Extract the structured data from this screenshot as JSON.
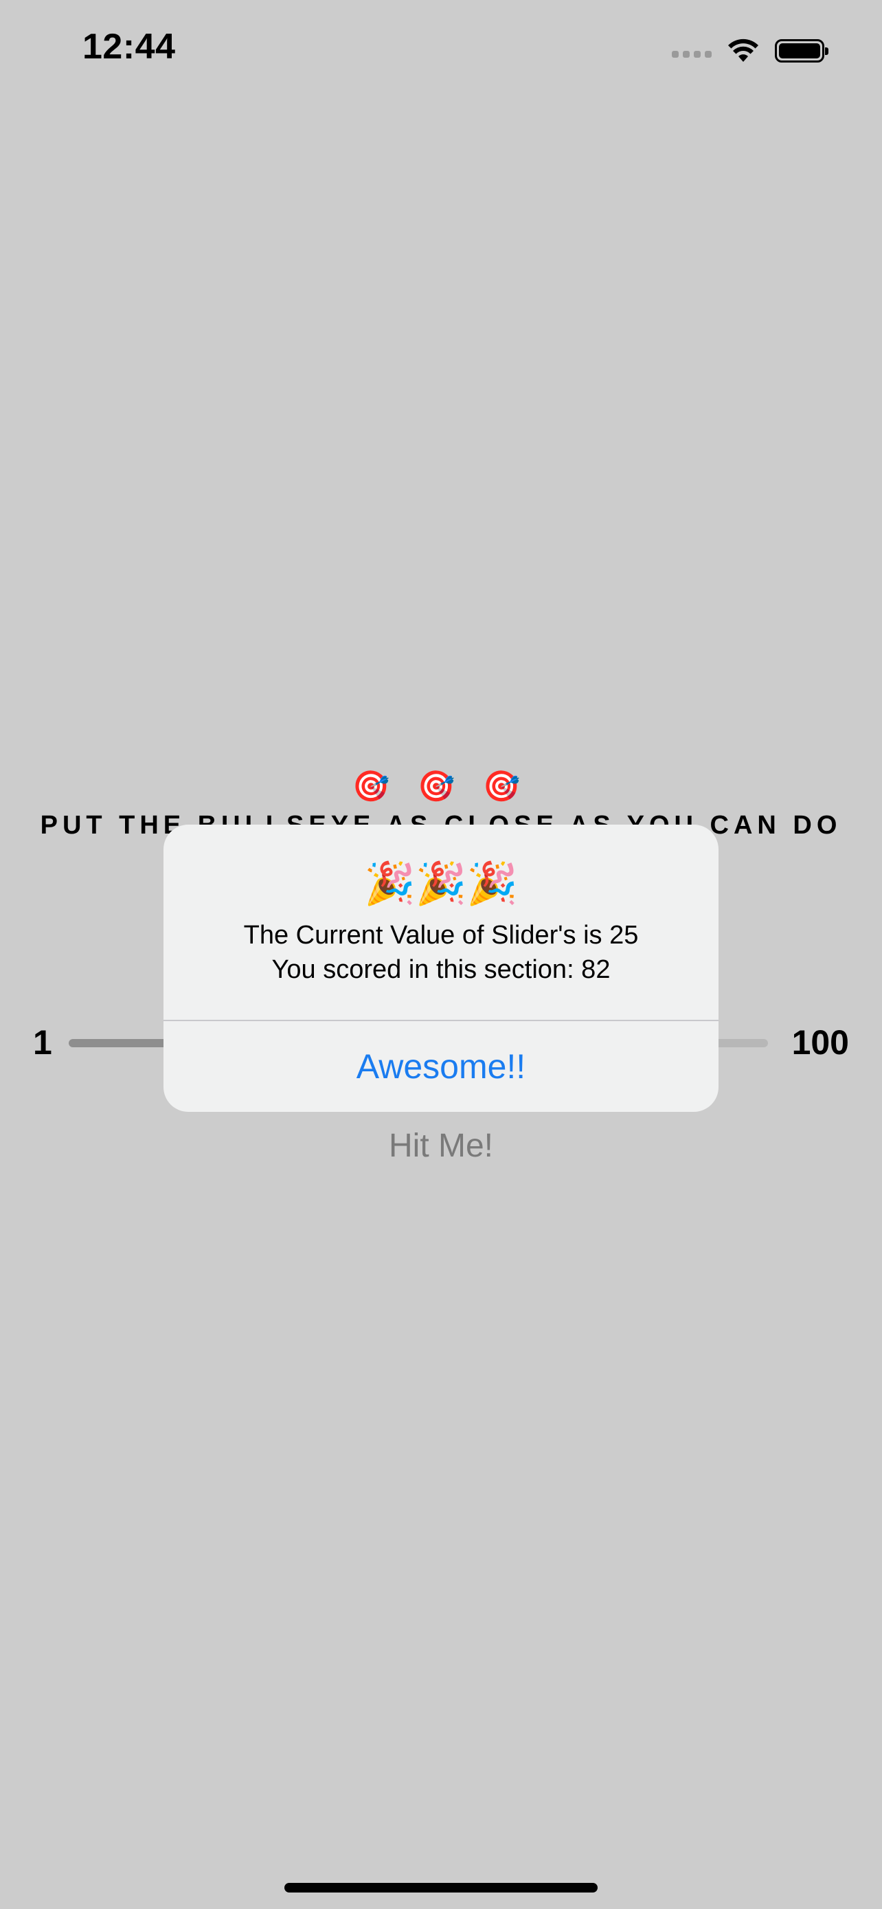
{
  "status_bar": {
    "time": "12:44",
    "signal_icon": "cellular-signal-icon",
    "wifi_icon": "wifi-icon",
    "battery_icon": "battery-icon",
    "battery_level": 1.0
  },
  "game": {
    "targets": "🎯 🎯 🎯",
    "instruction": "PUT THE BULLSEYE AS CLOSE AS YOU CAN DO",
    "slider": {
      "min_label": "1",
      "max_label": "100",
      "value": 25
    },
    "hit_button_label": "Hit Me!"
  },
  "alert": {
    "emoji": "🎉🎉🎉",
    "line1": "The Current Value of Slider's is 25",
    "line2": "You scored in this section: 82",
    "button_label": "Awesome!!",
    "button_color": "#1a7cf0"
  }
}
